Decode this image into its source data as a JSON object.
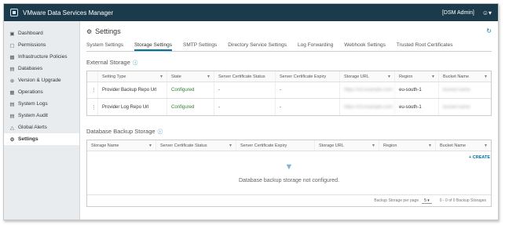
{
  "header": {
    "app_title": "VMware Data Services Manager",
    "user": "[DSM Admin]"
  },
  "sidebar": {
    "items": [
      {
        "label": "Dashboard",
        "icon": "dashboard-icon"
      },
      {
        "label": "Permissions",
        "icon": "permissions-icon"
      },
      {
        "label": "Infrastructure Policies",
        "icon": "policy-icon"
      },
      {
        "label": "Databases",
        "icon": "database-icon"
      },
      {
        "label": "Version & Upgrade",
        "icon": "upgrade-icon"
      },
      {
        "label": "Operations",
        "icon": "operations-icon"
      },
      {
        "label": "System Logs",
        "icon": "logs-icon"
      },
      {
        "label": "System Audit",
        "icon": "audit-icon"
      },
      {
        "label": "Global Alerts",
        "icon": "bell-icon"
      },
      {
        "label": "Settings",
        "icon": "gear-icon"
      }
    ]
  },
  "page": {
    "title": "Settings"
  },
  "tabs": [
    "System Settings",
    "Storage Settings",
    "SMTP Settings",
    "Directory Service Settings",
    "Log Forwarding",
    "Webhook Settings",
    "Trusted Root Certificates"
  ],
  "external_storage": {
    "title": "External Storage",
    "columns": [
      "Setting Type",
      "State",
      "Server Certificate Status",
      "Server Certificate Expiry",
      "Storage URL",
      "Region",
      "Bucket Name"
    ],
    "rows": [
      {
        "setting_type": "Provider Backup Repo Url",
        "state": "Configured",
        "cert_status": "-",
        "cert_expiry": "-",
        "storage_url": "https://s3.example.com",
        "region": "eu-south-1",
        "bucket": "bucket-name"
      },
      {
        "setting_type": "Provider Log Repo Url",
        "state": "Configured",
        "cert_status": "-",
        "cert_expiry": "-",
        "storage_url": "https://s3.example.com",
        "region": "eu-south-1",
        "bucket": "bucket-name"
      }
    ]
  },
  "backup_storage": {
    "title": "Database Backup Storage",
    "create_label": "+ CREATE",
    "columns": [
      "Storage Name",
      "Server Certificate Status",
      "Server Certificate Expiry",
      "Storage URL",
      "Region",
      "Bucket Name"
    ],
    "empty_text": "Database backup storage not configured.",
    "per_page_label": "Backup Storage per page",
    "per_page_value": "5",
    "range_label": "0 - 0 of 0 Backup Storages"
  }
}
